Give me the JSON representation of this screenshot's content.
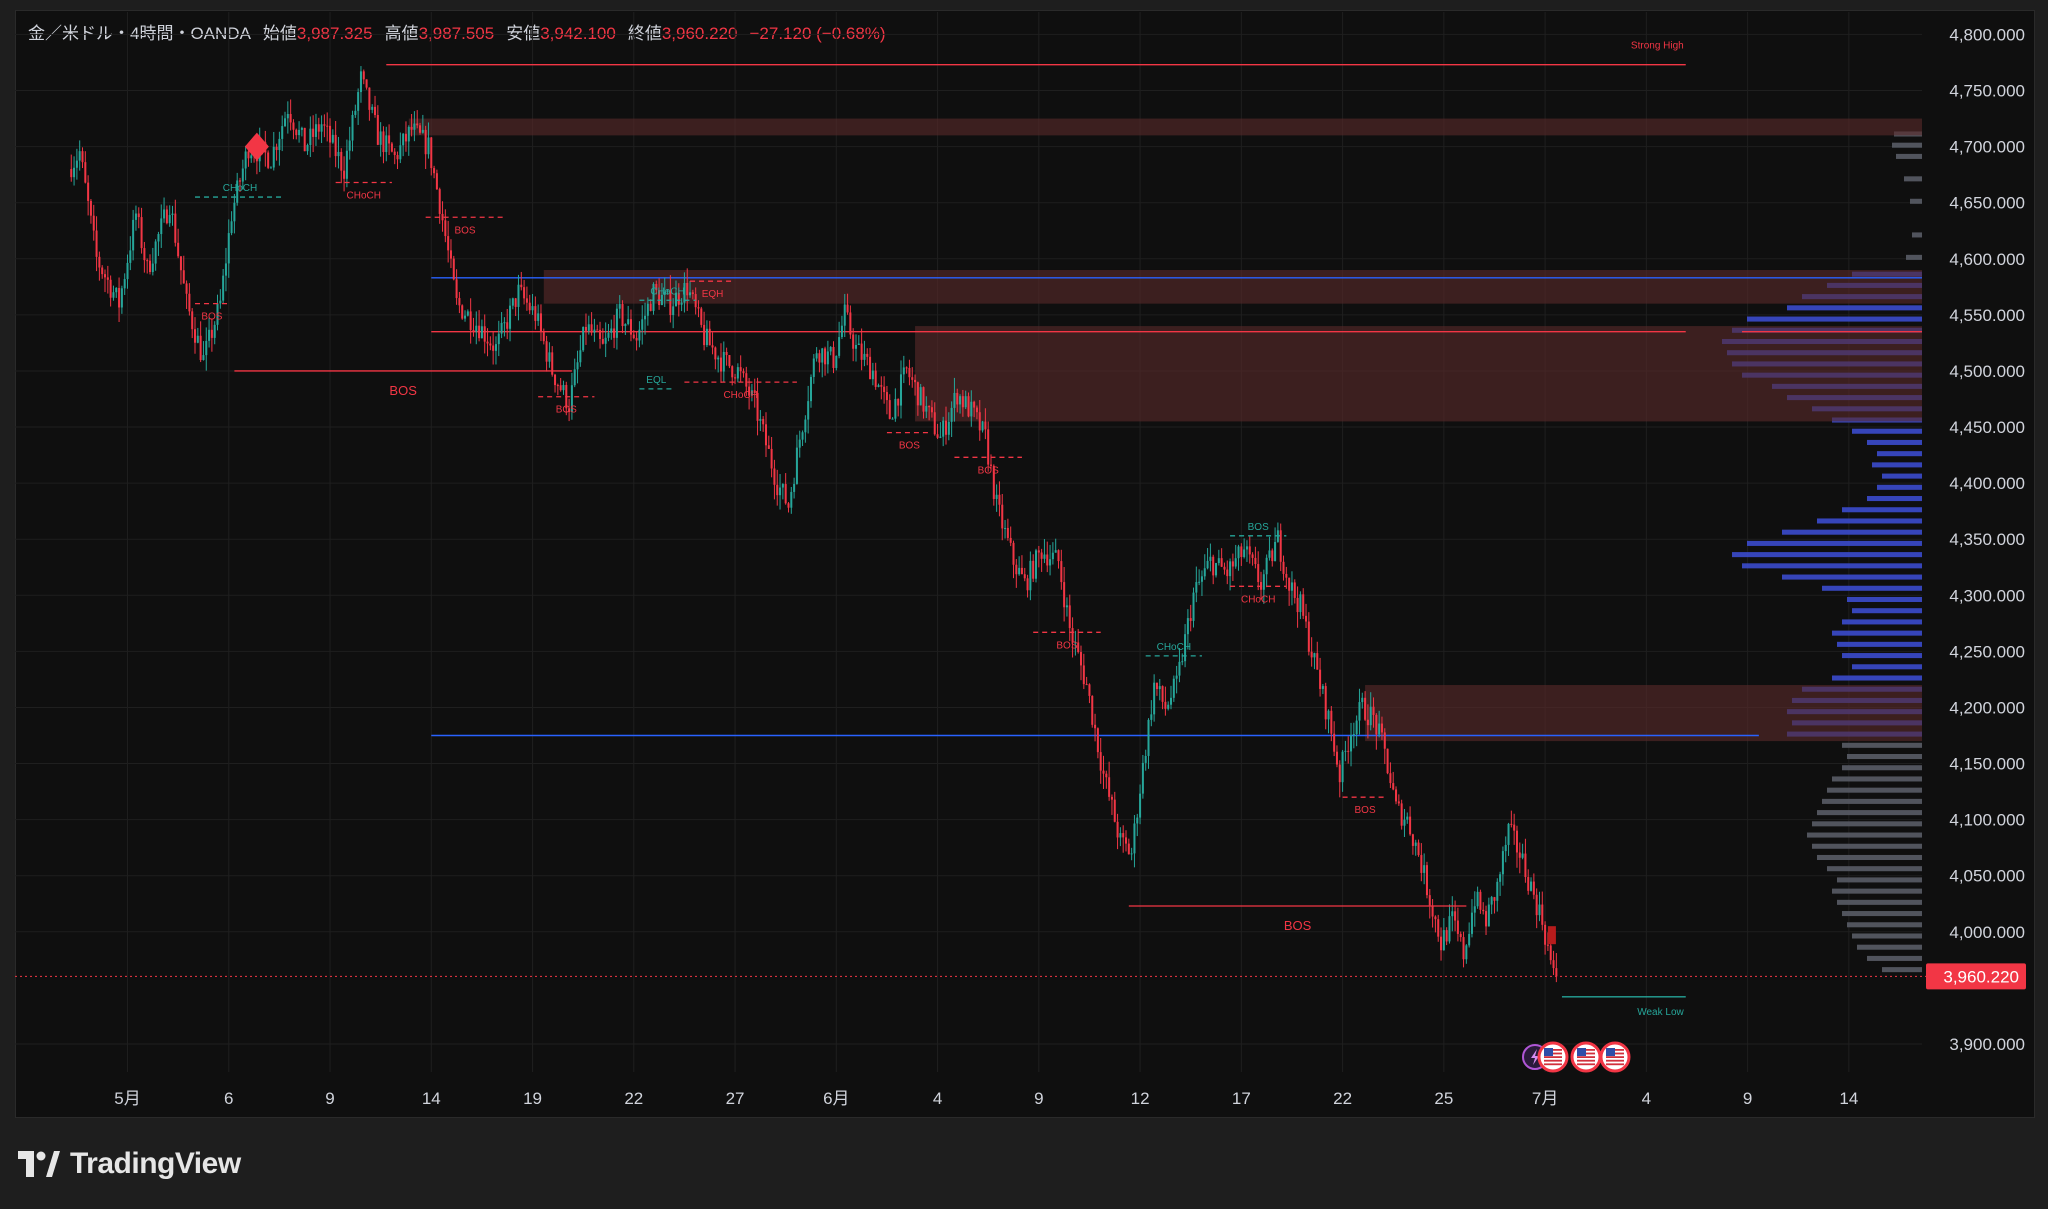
{
  "header": {
    "symbol": "金／米ドル・4時間・OANDA",
    "open_label": "始値",
    "open_value": "3,987.325",
    "high_label": "高値",
    "high_value": "3,987.505",
    "low_label": "安値",
    "low_value": "3,942.100",
    "close_label": "終値",
    "close_value": "3,960.220",
    "change": "−27.120 (−0.68%)"
  },
  "brand": {
    "name": "TradingView",
    "logo_icon": "tradingview-logo-icon"
  },
  "colors": {
    "up": "#26a69a",
    "down": "#f23645",
    "background": "#0f0f0f",
    "zone": "#5a2a2a",
    "level_blue": "#2962ff",
    "profile_blue": "#3d4fd8",
    "profile_gray": "#5d606b"
  },
  "chart_data": {
    "type": "candlestick",
    "title": "金／米ドル・4時間・OANDA",
    "last_price": 3960.22,
    "last_price_label": "3,960.220",
    "ylim": [
      3875,
      4820
    ],
    "y_ticks": [
      {
        "value": 4800,
        "label": "4,800.000"
      },
      {
        "value": 4750,
        "label": "4,750.000"
      },
      {
        "value": 4700,
        "label": "4,700.000"
      },
      {
        "value": 4650,
        "label": "4,650.000"
      },
      {
        "value": 4600,
        "label": "4,600.000"
      },
      {
        "value": 4550,
        "label": "4,550.000"
      },
      {
        "value": 4500,
        "label": "4,500.000"
      },
      {
        "value": 4450,
        "label": "4,450.000"
      },
      {
        "value": 4400,
        "label": "4,400.000"
      },
      {
        "value": 4350,
        "label": "4,350.000"
      },
      {
        "value": 4300,
        "label": "4,300.000"
      },
      {
        "value": 4250,
        "label": "4,250.000"
      },
      {
        "value": 4200,
        "label": "4,200.000"
      },
      {
        "value": 4150,
        "label": "4,150.000"
      },
      {
        "value": 4100,
        "label": "4,100.000"
      },
      {
        "value": 4050,
        "label": "4,050.000"
      },
      {
        "value": 4000,
        "label": "4,000.000"
      },
      {
        "value": 3900,
        "label": "3,900.000"
      }
    ],
    "x_ticks": [
      {
        "t": 10,
        "label": "5月"
      },
      {
        "t": 28,
        "label": "6"
      },
      {
        "t": 46,
        "label": "9"
      },
      {
        "t": 64,
        "label": "14"
      },
      {
        "t": 82,
        "label": "19"
      },
      {
        "t": 100,
        "label": "22"
      },
      {
        "t": 118,
        "label": "27"
      },
      {
        "t": 136,
        "label": "6月"
      },
      {
        "t": 154,
        "label": "4"
      },
      {
        "t": 172,
        "label": "9"
      },
      {
        "t": 190,
        "label": "12"
      },
      {
        "t": 208,
        "label": "17"
      },
      {
        "t": 226,
        "label": "22"
      },
      {
        "t": 244,
        "label": "25"
      },
      {
        "t": 262,
        "label": "7月"
      },
      {
        "t": 280,
        "label": "4"
      },
      {
        "t": 298,
        "label": "9"
      },
      {
        "t": 316,
        "label": "14"
      }
    ],
    "x_range": [
      -10,
      329
    ],
    "candle_keypoints": [
      [
        0,
        4680
      ],
      [
        2,
        4695
      ],
      [
        5,
        4600
      ],
      [
        9,
        4560
      ],
      [
        12,
        4640
      ],
      [
        14,
        4590
      ],
      [
        18,
        4650
      ],
      [
        21,
        4560
      ],
      [
        24,
        4510
      ],
      [
        27,
        4560
      ],
      [
        29,
        4640
      ],
      [
        32,
        4700
      ],
      [
        36,
        4690
      ],
      [
        39,
        4735
      ],
      [
        42,
        4700
      ],
      [
        45,
        4720
      ],
      [
        49,
        4680
      ],
      [
        52,
        4760
      ],
      [
        55,
        4710
      ],
      [
        58,
        4690
      ],
      [
        61,
        4715
      ],
      [
        64,
        4700
      ],
      [
        66,
        4650
      ],
      [
        69,
        4560
      ],
      [
        73,
        4540
      ],
      [
        76,
        4520
      ],
      [
        80,
        4570
      ],
      [
        83,
        4550
      ],
      [
        86,
        4500
      ],
      [
        89,
        4470
      ],
      [
        92,
        4540
      ],
      [
        95,
        4520
      ],
      [
        98,
        4550
      ],
      [
        101,
        4530
      ],
      [
        104,
        4570
      ],
      [
        107,
        4560
      ],
      [
        110,
        4575
      ],
      [
        113,
        4530
      ],
      [
        116,
        4510
      ],
      [
        119,
        4500
      ],
      [
        122,
        4470
      ],
      [
        126,
        4400
      ],
      [
        128,
        4380
      ],
      [
        130,
        4440
      ],
      [
        133,
        4520
      ],
      [
        136,
        4510
      ],
      [
        138,
        4550
      ],
      [
        140,
        4520
      ],
      [
        143,
        4500
      ],
      [
        146,
        4460
      ],
      [
        149,
        4500
      ],
      [
        152,
        4470
      ],
      [
        155,
        4440
      ],
      [
        158,
        4480
      ],
      [
        161,
        4460
      ],
      [
        163,
        4440
      ],
      [
        165,
        4380
      ],
      [
        168,
        4330
      ],
      [
        170,
        4310
      ],
      [
        173,
        4340
      ],
      [
        176,
        4330
      ],
      [
        178,
        4270
      ],
      [
        181,
        4220
      ],
      [
        184,
        4140
      ],
      [
        187,
        4080
      ],
      [
        189,
        4070
      ],
      [
        190,
        4110
      ],
      [
        193,
        4220
      ],
      [
        195,
        4200
      ],
      [
        197,
        4220
      ],
      [
        200,
        4300
      ],
      [
        203,
        4330
      ],
      [
        206,
        4320
      ],
      [
        209,
        4340
      ],
      [
        212,
        4310
      ],
      [
        215,
        4350
      ],
      [
        217,
        4310
      ],
      [
        219,
        4290
      ],
      [
        222,
        4230
      ],
      [
        224,
        4190
      ],
      [
        226,
        4140
      ],
      [
        228,
        4180
      ],
      [
        230,
        4200
      ],
      [
        232,
        4190
      ],
      [
        234,
        4160
      ],
      [
        236,
        4110
      ],
      [
        238,
        4100
      ],
      [
        240,
        4070
      ],
      [
        242,
        4030
      ],
      [
        244,
        3990
      ],
      [
        246,
        4010
      ],
      [
        248,
        3980
      ],
      [
        250,
        4030
      ],
      [
        252,
        4010
      ],
      [
        254,
        4040
      ],
      [
        256,
        4090
      ],
      [
        258,
        4070
      ],
      [
        260,
        4040
      ],
      [
        262,
        4010
      ],
      [
        264,
        3960
      ]
    ],
    "zones": [
      {
        "t1": 60,
        "t2": 329,
        "y1": 4710,
        "y2": 4725
      },
      {
        "t1": 84,
        "t2": 329,
        "y1": 4560,
        "y2": 4590
      },
      {
        "t1": 150,
        "t2": 329,
        "y1": 4455,
        "y2": 4540
      },
      {
        "t1": 230,
        "t2": 329,
        "y1": 4170,
        "y2": 4220
      }
    ],
    "levels": [
      {
        "t1": 56,
        "t2": 287,
        "y": 4773,
        "color": "red",
        "label": "Strong High"
      },
      {
        "t1": 64,
        "t2": 329,
        "y": 4583,
        "color": "blue",
        "label": ""
      },
      {
        "t1": 64,
        "t2": 287,
        "y": 4535,
        "color": "red",
        "label": ""
      },
      {
        "t1": 297,
        "t2": 329,
        "y": 4535,
        "color": "red",
        "label": ""
      },
      {
        "t1": 64,
        "t2": 300,
        "y": 4175,
        "color": "blue",
        "label": ""
      },
      {
        "t1": 265,
        "t2": 287,
        "y": 3942,
        "color": "green",
        "label": "Weak Low"
      }
    ],
    "structure_labels": [
      {
        "t": 30,
        "y": 4655,
        "text": "CHoCH",
        "color": "green",
        "dashed_from": 22
      },
      {
        "t": 52,
        "y": 4668,
        "text": "CHoCH",
        "color": "red",
        "dashed_from": 47
      },
      {
        "t": 70,
        "y": 4637,
        "text": "BOS",
        "color": "red",
        "dashed_from": 63
      },
      {
        "t": 25,
        "y": 4560,
        "text": "BOS",
        "color": "red",
        "dashed_from": 22
      },
      {
        "t": 59,
        "y": 4500,
        "text": "BOS",
        "color": "red",
        "dashed_from": 29,
        "solid": true
      },
      {
        "t": 88,
        "y": 4477,
        "text": "BOS",
        "color": "red",
        "dashed_from": 83
      },
      {
        "t": 114,
        "y": 4580,
        "text": "EQH",
        "color": "red",
        "dashed_from": 110
      },
      {
        "t": 106,
        "y": 4563,
        "text": "CHoCH",
        "color": "green",
        "dashed_from": 101
      },
      {
        "t": 104,
        "y": 4484,
        "text": "EQL",
        "color": "green",
        "dashed_from": 101
      },
      {
        "t": 119,
        "y": 4490,
        "text": "CHoCH",
        "color": "red",
        "dashed_from": 109
      },
      {
        "t": 149,
        "y": 4445,
        "text": "BOS",
        "color": "red",
        "dashed_from": 145
      },
      {
        "t": 163,
        "y": 4423,
        "text": "BOS",
        "color": "red",
        "dashed_from": 157
      },
      {
        "t": 177,
        "y": 4267,
        "text": "BOS",
        "color": "red",
        "dashed_from": 171
      },
      {
        "t": 196,
        "y": 4246,
        "text": "CHoCH",
        "color": "green",
        "dashed_from": 191
      },
      {
        "t": 211,
        "y": 4353,
        "text": "BOS",
        "color": "green",
        "dashed_from": 206
      },
      {
        "t": 211,
        "y": 4308,
        "text": "CHoCH",
        "color": "red",
        "dashed_from": 206
      },
      {
        "t": 230,
        "y": 4120,
        "text": "BOS",
        "color": "red",
        "dashed_from": 226
      },
      {
        "t": 218,
        "y": 4023,
        "text": "BOS",
        "color": "red",
        "dashed_from": 188,
        "solid": true
      }
    ],
    "volume_profile": [
      {
        "y": 4710,
        "w": 28,
        "c": "gray"
      },
      {
        "y": 4700,
        "w": 30,
        "c": "gray"
      },
      {
        "y": 4690,
        "w": 26,
        "c": "gray"
      },
      {
        "y": 4670,
        "w": 18,
        "c": "gray"
      },
      {
        "y": 4650,
        "w": 12,
        "c": "gray"
      },
      {
        "y": 4620,
        "w": 10,
        "c": "gray"
      },
      {
        "y": 4600,
        "w": 16,
        "c": "gray"
      },
      {
        "y": 4585,
        "w": 70,
        "c": "blue"
      },
      {
        "y": 4575,
        "w": 95,
        "c": "blue"
      },
      {
        "y": 4565,
        "w": 120,
        "c": "blue"
      },
      {
        "y": 4555,
        "w": 135,
        "c": "blue"
      },
      {
        "y": 4545,
        "w": 175,
        "c": "blue"
      },
      {
        "y": 4535,
        "w": 190,
        "c": "blue"
      },
      {
        "y": 4525,
        "w": 200,
        "c": "blue"
      },
      {
        "y": 4515,
        "w": 195,
        "c": "blue"
      },
      {
        "y": 4505,
        "w": 190,
        "c": "blue"
      },
      {
        "y": 4495,
        "w": 180,
        "c": "blue"
      },
      {
        "y": 4485,
        "w": 150,
        "c": "blue"
      },
      {
        "y": 4475,
        "w": 135,
        "c": "blue"
      },
      {
        "y": 4465,
        "w": 110,
        "c": "blue"
      },
      {
        "y": 4455,
        "w": 90,
        "c": "blue"
      },
      {
        "y": 4445,
        "w": 70,
        "c": "blue"
      },
      {
        "y": 4435,
        "w": 55,
        "c": "blue"
      },
      {
        "y": 4425,
        "w": 45,
        "c": "blue"
      },
      {
        "y": 4415,
        "w": 50,
        "c": "blue"
      },
      {
        "y": 4405,
        "w": 40,
        "c": "blue"
      },
      {
        "y": 4395,
        "w": 45,
        "c": "blue"
      },
      {
        "y": 4385,
        "w": 55,
        "c": "blue"
      },
      {
        "y": 4375,
        "w": 80,
        "c": "blue"
      },
      {
        "y": 4365,
        "w": 105,
        "c": "blue"
      },
      {
        "y": 4355,
        "w": 140,
        "c": "blue"
      },
      {
        "y": 4345,
        "w": 175,
        "c": "blue"
      },
      {
        "y": 4335,
        "w": 190,
        "c": "blue"
      },
      {
        "y": 4325,
        "w": 180,
        "c": "blue"
      },
      {
        "y": 4315,
        "w": 140,
        "c": "blue"
      },
      {
        "y": 4305,
        "w": 100,
        "c": "blue"
      },
      {
        "y": 4295,
        "w": 75,
        "c": "blue"
      },
      {
        "y": 4285,
        "w": 70,
        "c": "blue"
      },
      {
        "y": 4275,
        "w": 80,
        "c": "blue"
      },
      {
        "y": 4265,
        "w": 90,
        "c": "blue"
      },
      {
        "y": 4255,
        "w": 85,
        "c": "blue"
      },
      {
        "y": 4245,
        "w": 80,
        "c": "blue"
      },
      {
        "y": 4235,
        "w": 70,
        "c": "blue"
      },
      {
        "y": 4225,
        "w": 90,
        "c": "blue"
      },
      {
        "y": 4215,
        "w": 120,
        "c": "blue"
      },
      {
        "y": 4205,
        "w": 130,
        "c": "blue"
      },
      {
        "y": 4195,
        "w": 135,
        "c": "blue"
      },
      {
        "y": 4185,
        "w": 130,
        "c": "blue"
      },
      {
        "y": 4175,
        "w": 135,
        "c": "blue"
      },
      {
        "y": 4165,
        "w": 80,
        "c": "gray"
      },
      {
        "y": 4155,
        "w": 75,
        "c": "gray"
      },
      {
        "y": 4145,
        "w": 80,
        "c": "gray"
      },
      {
        "y": 4135,
        "w": 90,
        "c": "gray"
      },
      {
        "y": 4125,
        "w": 95,
        "c": "gray"
      },
      {
        "y": 4115,
        "w": 100,
        "c": "gray"
      },
      {
        "y": 4105,
        "w": 105,
        "c": "gray"
      },
      {
        "y": 4095,
        "w": 110,
        "c": "gray"
      },
      {
        "y": 4085,
        "w": 115,
        "c": "gray"
      },
      {
        "y": 4075,
        "w": 110,
        "c": "gray"
      },
      {
        "y": 4065,
        "w": 105,
        "c": "gray"
      },
      {
        "y": 4055,
        "w": 95,
        "c": "gray"
      },
      {
        "y": 4045,
        "w": 85,
        "c": "gray"
      },
      {
        "y": 4035,
        "w": 90,
        "c": "gray"
      },
      {
        "y": 4025,
        "w": 85,
        "c": "gray"
      },
      {
        "y": 4015,
        "w": 80,
        "c": "gray"
      },
      {
        "y": 4005,
        "w": 75,
        "c": "gray"
      },
      {
        "y": 3995,
        "w": 70,
        "c": "gray"
      },
      {
        "y": 3985,
        "w": 65,
        "c": "gray"
      },
      {
        "y": 3975,
        "w": 55,
        "c": "gray"
      },
      {
        "y": 3965,
        "w": 40,
        "c": "gray"
      }
    ],
    "grid": true,
    "event_icons": [
      "lightning-icon",
      "us-flag-icon",
      "us-flag-icon",
      "us-flag-icon"
    ]
  }
}
